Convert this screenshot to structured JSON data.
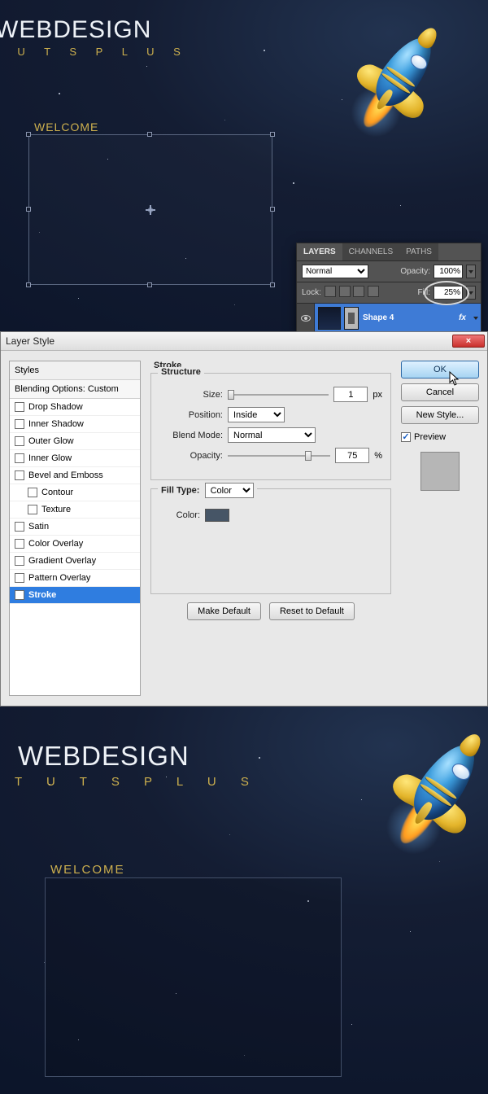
{
  "canvas": {
    "logo_main": "WEBDESIGN",
    "logo_sub": "T U T S P L U S",
    "welcome": "WELCOME"
  },
  "layers_panel": {
    "tabs": {
      "layers": "LAYERS",
      "channels": "CHANNELS",
      "paths": "PATHS"
    },
    "blend_mode": "Normal",
    "opacity_label": "Opacity:",
    "opacity_value": "100%",
    "lock_label": "Lock:",
    "fill_label": "Fill:",
    "fill_value": "25%",
    "layer_name": "Shape 4",
    "fx_label": "fx"
  },
  "dialog": {
    "title": "Layer Style",
    "close": "×",
    "styles_header": "Styles",
    "blending_header": "Blending Options: Custom",
    "items": {
      "drop_shadow": "Drop Shadow",
      "inner_shadow": "Inner Shadow",
      "outer_glow": "Outer Glow",
      "inner_glow": "Inner Glow",
      "bevel_emboss": "Bevel and Emboss",
      "contour": "Contour",
      "texture": "Texture",
      "satin": "Satin",
      "color_overlay": "Color Overlay",
      "gradient_overlay": "Gradient Overlay",
      "pattern_overlay": "Pattern Overlay",
      "stroke": "Stroke"
    },
    "section": "Stroke",
    "structure": {
      "legend": "Structure",
      "size_label": "Size:",
      "size_value": "1",
      "size_unit": "px",
      "position_label": "Position:",
      "position_value": "Inside",
      "blend_label": "Blend Mode:",
      "blend_value": "Normal",
      "opacity_label": "Opacity:",
      "opacity_value": "75",
      "opacity_unit": "%"
    },
    "fill": {
      "label": "Fill Type:",
      "value": "Color",
      "color_label": "Color:"
    },
    "buttons": {
      "make_default": "Make Default",
      "reset_default": "Reset to Default",
      "ok": "OK",
      "cancel": "Cancel",
      "new_style": "New Style...",
      "preview": "Preview"
    }
  }
}
